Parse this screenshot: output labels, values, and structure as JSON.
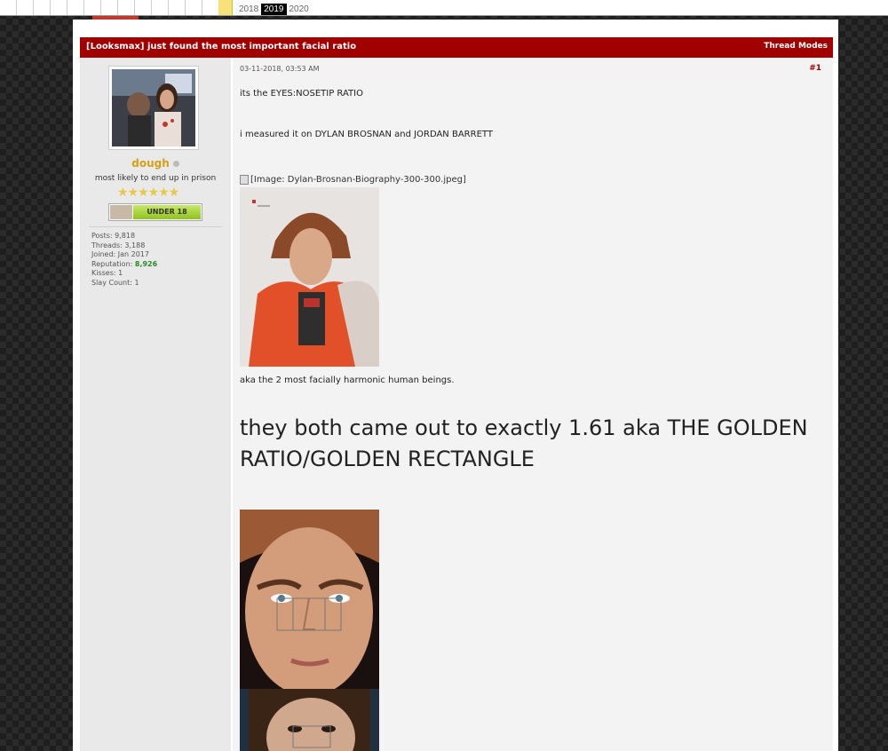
{
  "wayback": {
    "years": [
      "2018",
      "2019",
      "2020"
    ],
    "active_year": "2019"
  },
  "thread": {
    "title": "[Looksmax] just found the most important facial ratio",
    "modes_label": "Thread Modes"
  },
  "user": {
    "name": "dough",
    "title": "most likely to end up in prison",
    "stars": "★★★★★★",
    "badge": "UNDER 18",
    "stats": {
      "posts": "Posts: 9,818",
      "threads": "Threads: 3,188",
      "joined": "Joined: Jan 2017",
      "reputation_label": "Reputation: ",
      "reputation_value": "8,926",
      "kisses": "Kisses: 1",
      "slay": "Slay Count: 1"
    }
  },
  "post": {
    "date": "03-11-2018, 03:53 AM",
    "number": "#1",
    "line1": "its the EYES:NOSETIP RATIO",
    "line2": "i measured it on DYLAN BROSNAN and JORDAN BARRETT",
    "image_alt": "[Image: Dylan-Brosnan-Biography-300-300.jpeg]",
    "line3": "aka the 2 most facially harmonic  human beings.",
    "headline": "they both came out to exactly 1.61 aka THE GOLDEN RATIO/GOLDEN RECTANGLE"
  },
  "colors": {
    "header_red": "#a00000",
    "username_gold": "#d4a017",
    "reputation_green": "#2a8a2a"
  }
}
